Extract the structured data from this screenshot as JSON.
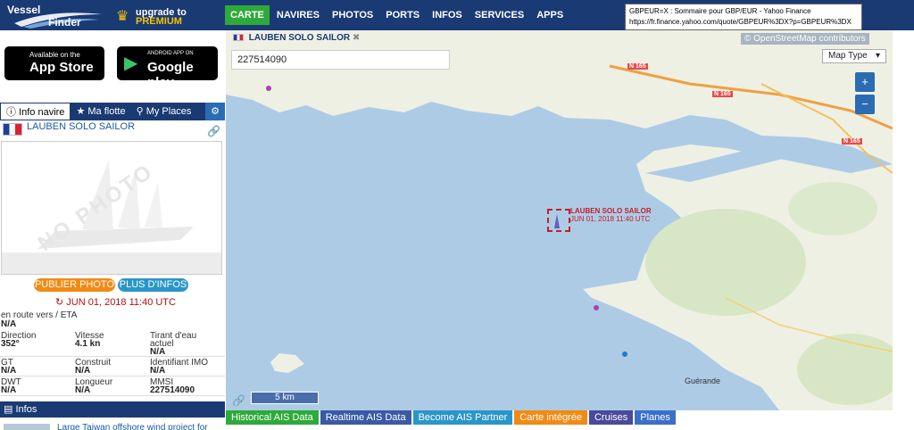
{
  "logo": {
    "line1": "Vessel",
    "line2": "Finder"
  },
  "premium": {
    "line1": "upgrade to",
    "line2": "PREMIUM"
  },
  "nav": [
    {
      "label": "CARTE",
      "active": true
    },
    {
      "label": "NAVIRES"
    },
    {
      "label": "PHOTOS"
    },
    {
      "label": "PORTS"
    },
    {
      "label": "INFOS"
    },
    {
      "label": "SERVICES"
    },
    {
      "label": "APPS"
    }
  ],
  "tooltip": {
    "title": "GBPEUR=X : Sommaire pour GBP/EUR - Yahoo Finance",
    "url": "https://fr.finance.yahoo.com/quote/GBPEUR%3DX?p=GBPEUR%3DX"
  },
  "stores": {
    "apple": {
      "small": "Available on the",
      "big": "App Store"
    },
    "google": {
      "small": "ANDROID APP ON",
      "big": "Google play"
    }
  },
  "sidebar_tabs": [
    {
      "label": "Info navire",
      "active": true
    },
    {
      "label": "Ma flotte"
    },
    {
      "label": "My Places"
    }
  ],
  "vessel": {
    "name": "LAUBEN SOLO SAILOR",
    "photo_watermark": "NO PHOTO",
    "publish_label": "PUBLIER PHOTO",
    "more_label": "PLUS D'INFOS",
    "date": "JUN 01, 2018 11:40 UTC",
    "enroute_label": "en route vers / ETA",
    "enroute_value": "N/A"
  },
  "stats": [
    [
      {
        "label": "Direction",
        "value": "352°"
      },
      {
        "label": "Vitesse",
        "value": "4.1 kn"
      },
      {
        "label": "Tirant d'eau actuel",
        "value": "N/A"
      }
    ],
    [
      {
        "label": "GT",
        "value": "N/A"
      },
      {
        "label": "Construit",
        "value": "N/A"
      },
      {
        "label": "Identifiant IMO",
        "value": "N/A"
      }
    ],
    [
      {
        "label": "DWT",
        "value": "N/A"
      },
      {
        "label": "Longueur",
        "value": "N/A"
      },
      {
        "label": "MMSI",
        "value": "227514090"
      }
    ]
  ],
  "infos": {
    "header": "Infos",
    "news": "Large Taiwan offshore wind project for"
  },
  "map": {
    "tag": "LAUBEN SOLO SAILOR",
    "search_value": "227514090",
    "attribution": "© OpenStreetMap contributors",
    "map_type": "Map Type",
    "zoom_in": "+",
    "zoom_out": "−",
    "ship_label": "LAUBEN SOLO SAILOR",
    "ship_date": "JUN 01, 2018 11:40 UTC",
    "scale": "5 km",
    "roads": [
      "N 165",
      "N 165",
      "N 165"
    ],
    "place": "Guérande"
  },
  "bottom_buttons": [
    {
      "label": "Historical AIS Data",
      "color": "#2eaa3a"
    },
    {
      "label": "Realtime AIS Data",
      "color": "#3a5aa5"
    },
    {
      "label": "Become AIS Partner",
      "color": "#2a96c8"
    },
    {
      "label": "Carte intégrée",
      "color": "#f28a14"
    },
    {
      "label": "Cruises",
      "color": "#4a4a9a"
    },
    {
      "label": "Planes",
      "color": "#3a70c8"
    }
  ]
}
